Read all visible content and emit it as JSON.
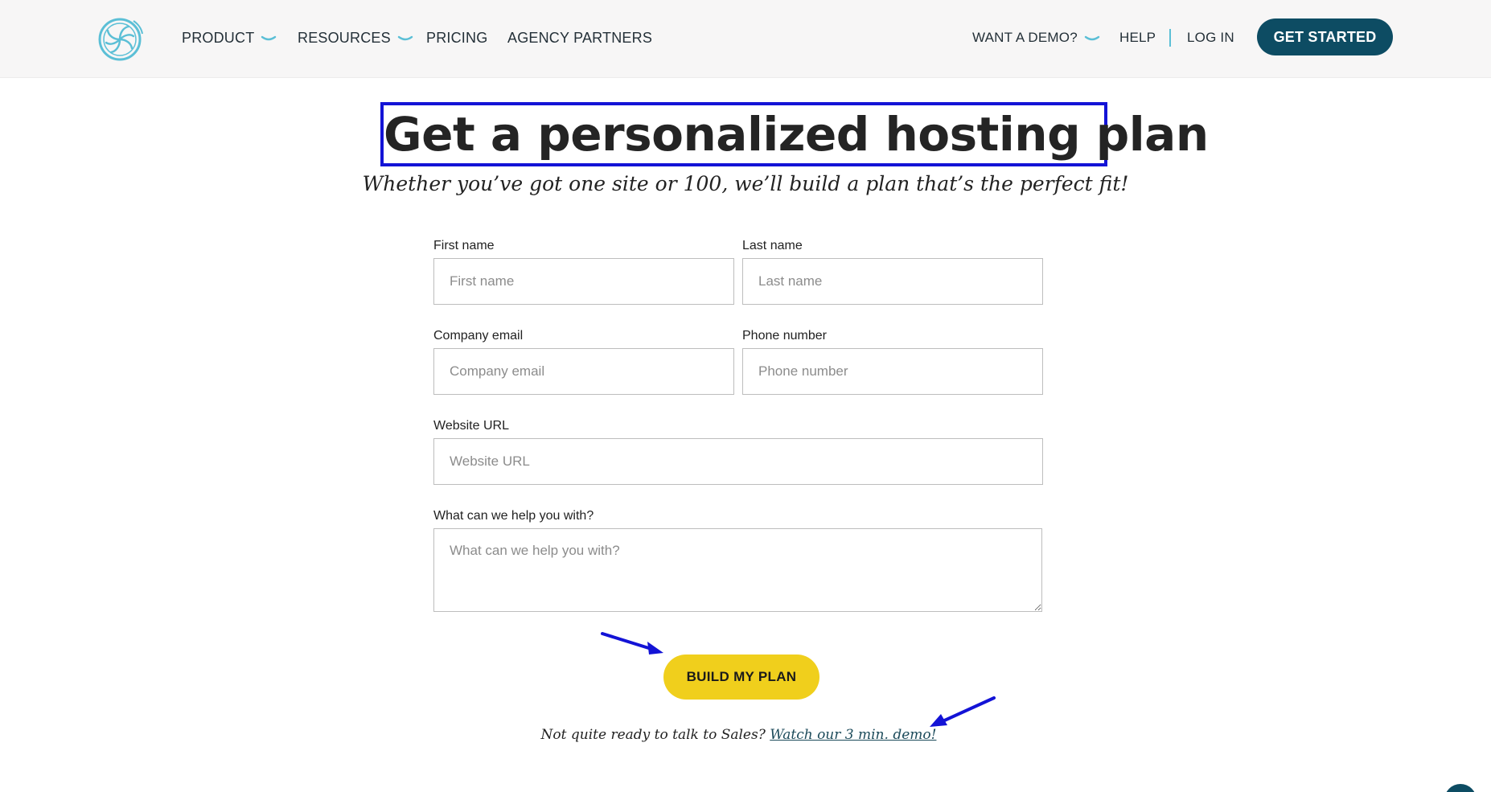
{
  "header": {
    "nav": [
      {
        "label": "PRODUCT",
        "has_dropdown": true
      },
      {
        "label": "RESOURCES",
        "has_dropdown": true
      },
      {
        "label": "PRICING",
        "has_dropdown": false
      },
      {
        "label": "AGENCY PARTNERS",
        "has_dropdown": false
      }
    ],
    "right_nav": [
      {
        "label": "WANT A DEMO?",
        "has_dropdown": true
      },
      {
        "label": "HELP",
        "has_dropdown": false
      },
      {
        "label": "LOG IN",
        "has_dropdown": false
      }
    ],
    "cta_label": "GET STARTED",
    "logo_icon": "flywheel-logo-icon"
  },
  "hero": {
    "title": "Get a personalized hosting plan",
    "subtitle": "Whether you’ve got one site or 100, we’ll build a plan that’s the perfect fit!"
  },
  "form": {
    "first_name": {
      "label": "First name",
      "placeholder": "First name",
      "value": ""
    },
    "last_name": {
      "label": "Last name",
      "placeholder": "Last name",
      "value": ""
    },
    "company_email": {
      "label": "Company email",
      "placeholder": "Company email",
      "value": ""
    },
    "phone_number": {
      "label": "Phone number",
      "placeholder": "Phone number",
      "value": ""
    },
    "website_url": {
      "label": "Website URL",
      "placeholder": "Website URL",
      "value": ""
    },
    "help_text": {
      "label": "What can we help you with?",
      "placeholder": "What can we help you with?",
      "value": ""
    },
    "submit_label": "BUILD MY PLAN"
  },
  "footer_note": {
    "text": "Not quite ready to talk to Sales? ",
    "link_label": "Watch our 3 min. demo!"
  },
  "colors": {
    "brand_dark": "#0d4c63",
    "brand_accent": "#5bbfd6",
    "cta_yellow": "#f0cf1c",
    "annotation_blue": "#1313d6"
  }
}
